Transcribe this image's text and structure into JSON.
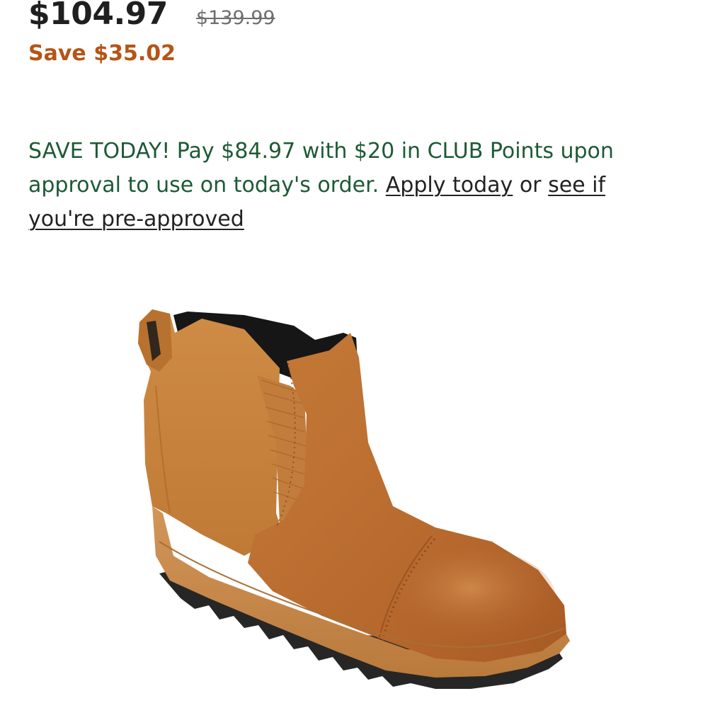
{
  "pricing": {
    "current_price": "$104.97",
    "original_price": "$139.99",
    "savings_label": "Save $35.02"
  },
  "promo": {
    "message": "SAVE TODAY! Pay $84.97 with $20 in CLUB Points upon approval to use on today's order.",
    "apply_link": "Apply today",
    "connector": "or",
    "preapproved_link": "see if you're pre-approved"
  },
  "colors": {
    "savings": "#b55416",
    "promo_text": "#1d5a34",
    "boot_leather": "#b86a2e",
    "boot_suede": "#c8853e",
    "sole": "#c98a47",
    "tread": "#2a2a2a"
  },
  "product_image": {
    "icon": "ankle-boot-image"
  }
}
